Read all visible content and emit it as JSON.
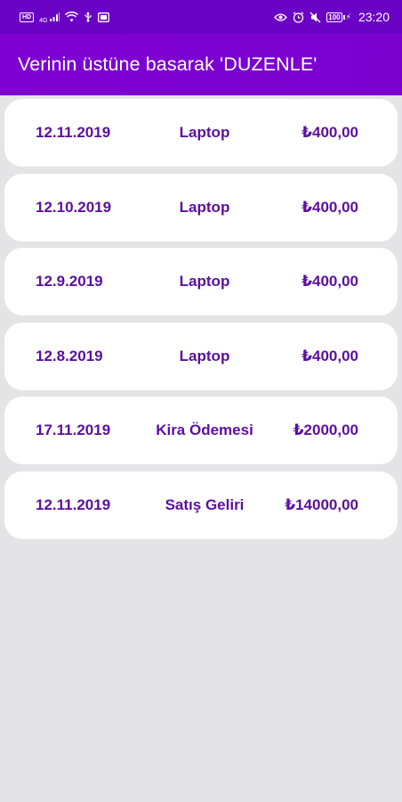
{
  "status_bar": {
    "left_badges": {
      "hd": "HD",
      "signal_type": "4G"
    },
    "battery": "100",
    "time": "23:20",
    "icons": [
      "hd-icon",
      "signal-icon",
      "wifi-icon",
      "usb-icon",
      "sim-icon",
      "eye-icon",
      "alarm-icon",
      "mute-icon",
      "battery-icon"
    ]
  },
  "app_bar": {
    "title": "Verinin üstüne basarak 'DUZENLE'"
  },
  "records": [
    {
      "date": "12.11.2019",
      "description": "Laptop",
      "amount": "₺400,00"
    },
    {
      "date": "12.10.2019",
      "description": "Laptop",
      "amount": "₺400,00"
    },
    {
      "date": "12.9.2019",
      "description": "Laptop",
      "amount": "₺400,00"
    },
    {
      "date": "12.8.2019",
      "description": "Laptop",
      "amount": "₺400,00"
    },
    {
      "date": "17.11.2019",
      "description": "Kira Ödemesi",
      "amount": "₺2000,00"
    },
    {
      "date": "12.11.2019",
      "description": "Satış Geliri",
      "amount": "₺14000,00"
    }
  ],
  "colors": {
    "primary": "#7a02cf",
    "status_bar": "#6a02c6",
    "row_text": "#5b0fa0",
    "background": "#e4e4e6",
    "row_bg": "#ffffff"
  }
}
